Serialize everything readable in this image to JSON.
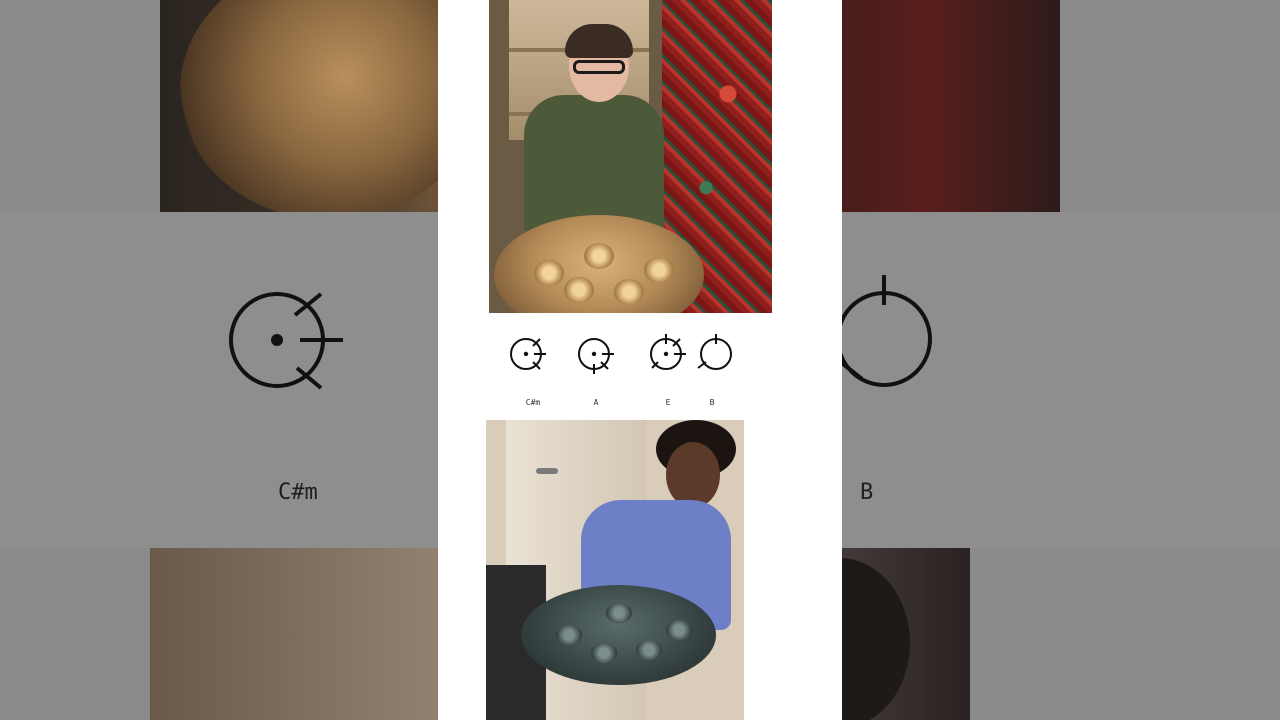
{
  "chords": [
    {
      "name": "C#m"
    },
    {
      "name": "A"
    },
    {
      "name": "E"
    },
    {
      "name": "B"
    }
  ],
  "background_labels": {
    "left": "C#m",
    "right": "B"
  },
  "colors": {
    "card": "#ffffff",
    "backdrop": "#8e8e8e",
    "symbol": "#111111"
  }
}
